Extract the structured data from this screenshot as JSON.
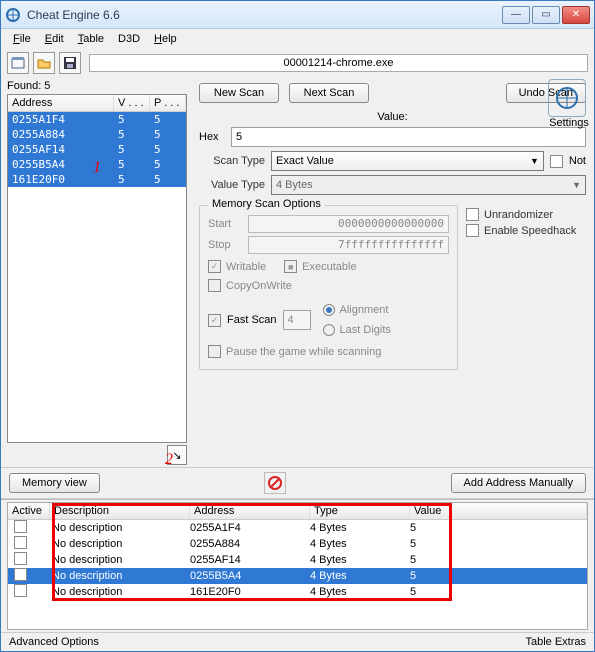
{
  "window": {
    "title": "Cheat Engine 6.6"
  },
  "menu": {
    "file": "File",
    "edit": "Edit",
    "table": "Table",
    "d3d": "D3D",
    "help": "Help"
  },
  "process": "00001214-chrome.exe",
  "found_label": "Found: 5",
  "result_cols": {
    "address": "Address",
    "value": "V . . .",
    "prev": "P . . ."
  },
  "results": [
    {
      "address": "0255A1F4",
      "value": "5",
      "prev": "5"
    },
    {
      "address": "0255A884",
      "value": "5",
      "prev": "5"
    },
    {
      "address": "0255AF14",
      "value": "5",
      "prev": "5"
    },
    {
      "address": "0255B5A4",
      "value": "5",
      "prev": "5"
    },
    {
      "address": "161E20F0",
      "value": "5",
      "prev": "5"
    }
  ],
  "buttons": {
    "new_scan": "New Scan",
    "next_scan": "Next Scan",
    "undo_scan": "Undo Scan",
    "memory_view": "Memory view",
    "add_manual": "Add Address Manually"
  },
  "settings_label": "Settings",
  "value_section": {
    "label": "Value:",
    "hex": "Hex",
    "value": "5"
  },
  "scantype": {
    "label": "Scan Type",
    "value": "Exact Value",
    "not": "Not"
  },
  "valuetype": {
    "label": "Value Type",
    "value": "4 Bytes"
  },
  "mso": {
    "title": "Memory Scan Options",
    "start_label": "Start",
    "start": "0000000000000000",
    "stop_label": "Stop",
    "stop": "7fffffffffffffff",
    "writable": "Writable",
    "executable": "Executable",
    "copyonwrite": "CopyOnWrite",
    "fastscan": "Fast Scan",
    "fastscan_val": "4",
    "alignment": "Alignment",
    "lastdigits": "Last Digits",
    "pause": "Pause the game while scanning"
  },
  "side_opts": {
    "unrand": "Unrandomizer",
    "speedhack": "Enable Speedhack"
  },
  "cheat_cols": {
    "active": "Active",
    "description": "Description",
    "address": "Address",
    "type": "Type",
    "value": "Value"
  },
  "cheat_rows": [
    {
      "desc": "No description",
      "address": "0255A1F4",
      "type": "4 Bytes",
      "value": "5",
      "sel": false
    },
    {
      "desc": "No description",
      "address": "0255A884",
      "type": "4 Bytes",
      "value": "5",
      "sel": false
    },
    {
      "desc": "No description",
      "address": "0255AF14",
      "type": "4 Bytes",
      "value": "5",
      "sel": false
    },
    {
      "desc": "No description",
      "address": "0255B5A4",
      "type": "4 Bytes",
      "value": "5",
      "sel": true
    },
    {
      "desc": "No description",
      "address": "161E20F0",
      "type": "4 Bytes",
      "value": "5",
      "sel": false
    }
  ],
  "bottom": {
    "adv": "Advanced Options",
    "extras": "Table Extras"
  },
  "anno": {
    "one": "1",
    "two": "2"
  }
}
